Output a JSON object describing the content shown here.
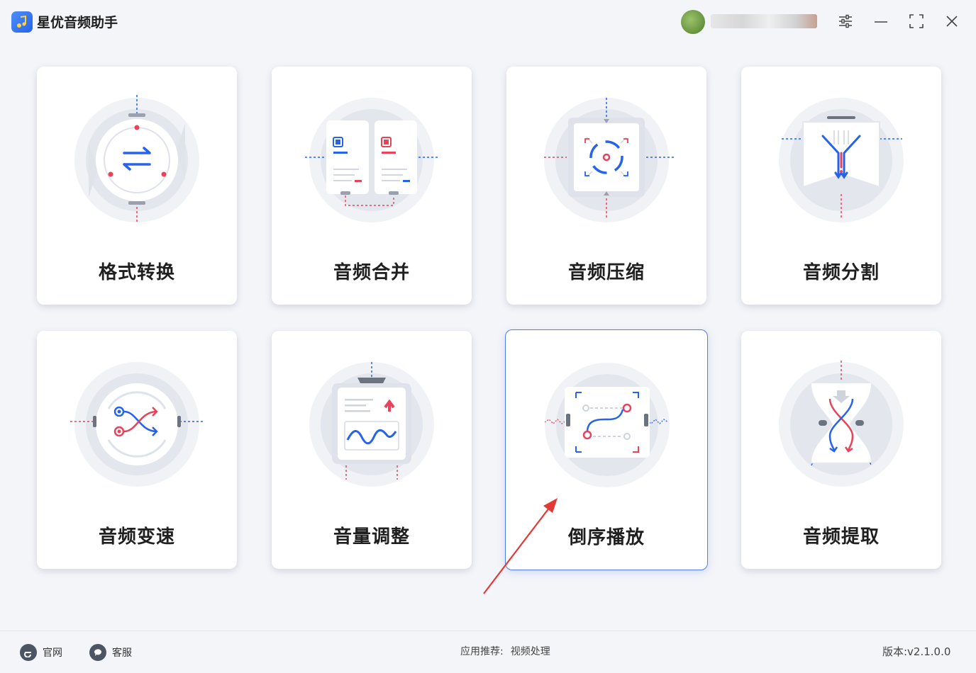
{
  "app": {
    "title": "星优音频助手"
  },
  "cards": [
    {
      "label": "格式转换"
    },
    {
      "label": "音频合并"
    },
    {
      "label": "音频压缩"
    },
    {
      "label": "音频分割"
    },
    {
      "label": "音频变速"
    },
    {
      "label": "音量调整"
    },
    {
      "label": "倒序播放"
    },
    {
      "label": "音频提取"
    }
  ],
  "footer": {
    "website": "官网",
    "support": "客服",
    "recommend_label": "应用推荐:",
    "recommend_value": "视频处理",
    "version": "版本:v2.1.0.0"
  },
  "colors": {
    "accent": "#2563eb",
    "red": "#e8435a",
    "active_border": "#4e7ff2"
  }
}
